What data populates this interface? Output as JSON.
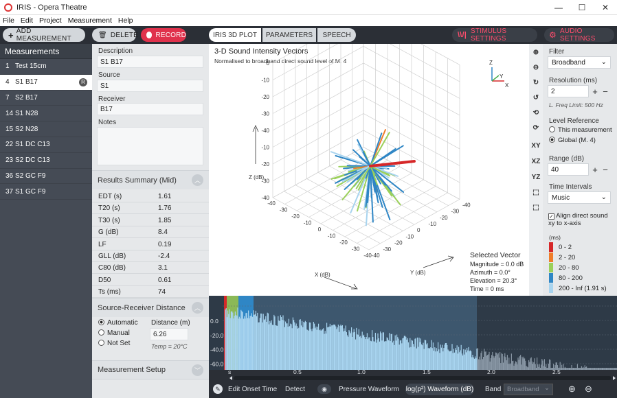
{
  "window": {
    "title": "IRIS - Opera Theatre",
    "min": "—",
    "max": "☐",
    "close": "✕"
  },
  "menu": [
    "File",
    "Edit",
    "Project",
    "Measurement",
    "Help"
  ],
  "toolbar": {
    "add_label": "ADD MEASUREMENT",
    "delete_label": "DELETE",
    "record_label": "RECORD",
    "tabs": [
      "IRIS 3D PLOT",
      "PARAMETERS",
      "SPEECH"
    ],
    "stimulus_label": "STIMULUS SETTINGS",
    "audio_label": "AUDIO SETTINGS"
  },
  "measurements": {
    "header": "Measurements",
    "items": [
      {
        "num": "1",
        "name": "Test 15cm"
      },
      {
        "num": "4",
        "name": "S1 B17",
        "badge": "R"
      },
      {
        "num": "7",
        "name": "S2 B17"
      },
      {
        "num": "14",
        "name": "S1 N28"
      },
      {
        "num": "15",
        "name": "S2 N28"
      },
      {
        "num": "22",
        "name": "S1 DC C13"
      },
      {
        "num": "23",
        "name": "S2 DC C13"
      },
      {
        "num": "36",
        "name": "S2 GC F9"
      },
      {
        "num": "37",
        "name": "S1 GC F9"
      }
    ]
  },
  "details": {
    "description_label": "Description",
    "description": "S1 B17",
    "source_label": "Source",
    "source": "S1",
    "receiver_label": "Receiver",
    "receiver": "B17",
    "notes_label": "Notes"
  },
  "results": {
    "header": "Results Summary (Mid)",
    "rows": [
      {
        "k": "EDT (s)",
        "v": "1.61"
      },
      {
        "k": "T20 (s)",
        "v": "1.76"
      },
      {
        "k": "T30 (s)",
        "v": "1.85"
      },
      {
        "k": "G (dB)",
        "v": "8.4"
      },
      {
        "k": "LF",
        "v": "0.19"
      },
      {
        "k": "GLL (dB)",
        "v": "-2.4"
      },
      {
        "k": "C80 (dB)",
        "v": "3.1"
      },
      {
        "k": "D50",
        "v": "0.61"
      },
      {
        "k": "Ts (ms)",
        "v": "74"
      }
    ]
  },
  "distance": {
    "header": "Source-Receiver Distance",
    "options": [
      "Automatic",
      "Manual",
      "Not Set"
    ],
    "dist_label": "Distance (m)",
    "dist_value": "6.26",
    "temp": "Temp = 20°C"
  },
  "setup": {
    "header": "Measurement Setup"
  },
  "plot": {
    "title": "3-D Sound Intensity Vectors",
    "subtitle": "Normalised to broadband direct sound level of M. 4",
    "z_label": "Z (dB)",
    "x_label": "X (dB)",
    "y_label": "Y (dB)",
    "z_ticks": [
      "0",
      "-10",
      "-20",
      "-30",
      "-40",
      "-10",
      "-20",
      "-30",
      "-40"
    ],
    "x_ticks": [
      "-40",
      "-30",
      "-20",
      "-10",
      "0",
      "-10",
      "-20",
      "-30",
      "-40"
    ],
    "y_ticks": [
      "-40",
      "-30",
      "-20",
      "-10",
      "0",
      "-10",
      "-20",
      "-30",
      "-40"
    ],
    "axis_letters": {
      "z": "Z",
      "y": "Y",
      "x": "X"
    },
    "selected": {
      "title": "Selected Vector",
      "magnitude": "Magnitude = 0.0 dB",
      "azimuth": "Azimuth = 0.0°",
      "elevation": "Elevation = 20.3°",
      "time": "Time = 0 ms"
    }
  },
  "icons": {
    "xy": "XY",
    "xz": "XZ",
    "yz": "YZ"
  },
  "settings": {
    "filter_label": "Filter",
    "filter_value": "Broadband",
    "resolution_label": "Resolution (ms)",
    "resolution_value": "2",
    "freq_limit": "L. Freq Limit: 500 Hz",
    "level_label": "Level Reference",
    "level_options": [
      "This measurement",
      "Global (M. 4)"
    ],
    "range_label": "Range (dB)",
    "range_value": "40",
    "time_label": "Time Intervals",
    "time_value": "Music",
    "align_label": "Align direct sound xy to x-axis",
    "legend_unit": "(ms)",
    "legend": [
      {
        "label": "0 - 2",
        "color": "#d62728"
      },
      {
        "label": "2 - 20",
        "color": "#f07d2a"
      },
      {
        "label": "20 - 80",
        "color": "#9bd05a"
      },
      {
        "label": "80 - 200",
        "color": "#2f86c5"
      },
      {
        "label": "200 - Inf (1.91 s)",
        "color": "#a8d4ef"
      }
    ]
  },
  "waveform": {
    "y_ticks": [
      "0.0",
      "-20.0",
      "-40.0",
      "-60.0",
      "-80.0"
    ],
    "x_ticks": [
      "s",
      "0.5",
      "1.0",
      "1.5",
      "2.0",
      "2.5"
    ]
  },
  "bottom": {
    "onset": "Edit Onset Time",
    "detect": "Detect",
    "pressure": "Pressure Waveform",
    "log": "log(p²) Waveform (dB)",
    "band_label": "Band",
    "band_value": "Broadband"
  }
}
